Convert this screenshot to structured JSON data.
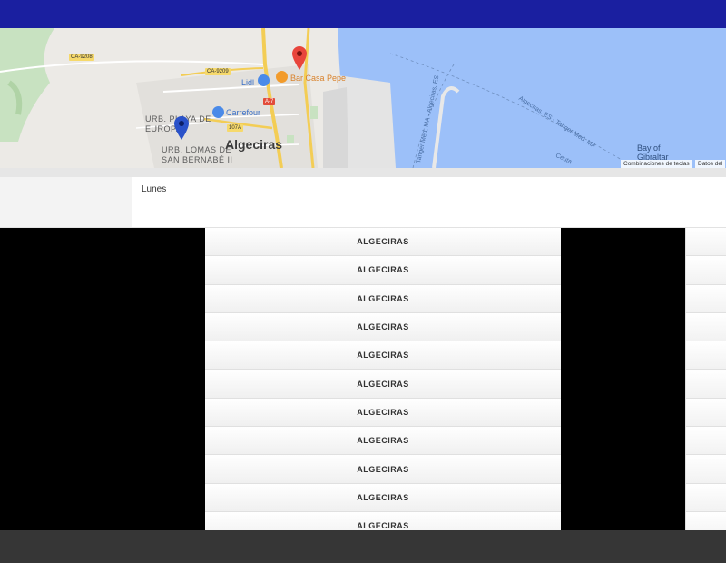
{
  "header": {
    "color": "#1a1fa0"
  },
  "map": {
    "city": "Algeciras",
    "districts": [
      {
        "id": "playa",
        "text": "URB. PLAYA DE EUROPA"
      },
      {
        "id": "lomas",
        "text": "URB. LOMAS DE SAN BERNABÉ II"
      }
    ],
    "roads": [
      "CA-9208",
      "CA-9209",
      "A-7",
      "107A"
    ],
    "pois": {
      "lidl": "Lidl",
      "carrefour": "Carrefour",
      "bar": "Bar Casa Pepe"
    },
    "routes": [
      "Tanger Med, MA - Algeciras, ES",
      "Algeciras, ES - Tanger Med, MA",
      "Ceuta"
    ],
    "bay": "Bay of Gibraltar",
    "attribution": {
      "shortcuts": "Combinaciones de teclas",
      "data": "Datos del"
    }
  },
  "info": {
    "day": "Lunes",
    "second": ""
  },
  "table": {
    "rows": [
      "ALGECIRAS",
      "ALGECIRAS",
      "ALGECIRAS",
      "ALGECIRAS",
      "ALGECIRAS",
      "ALGECIRAS",
      "ALGECIRAS",
      "ALGECIRAS",
      "ALGECIRAS",
      "ALGECIRAS",
      "ALGECIRAS"
    ]
  },
  "colors": {
    "sea": "#9cc0f9",
    "land": "#eceae6",
    "park": "#c8e2c1",
    "footer": "#363636"
  }
}
